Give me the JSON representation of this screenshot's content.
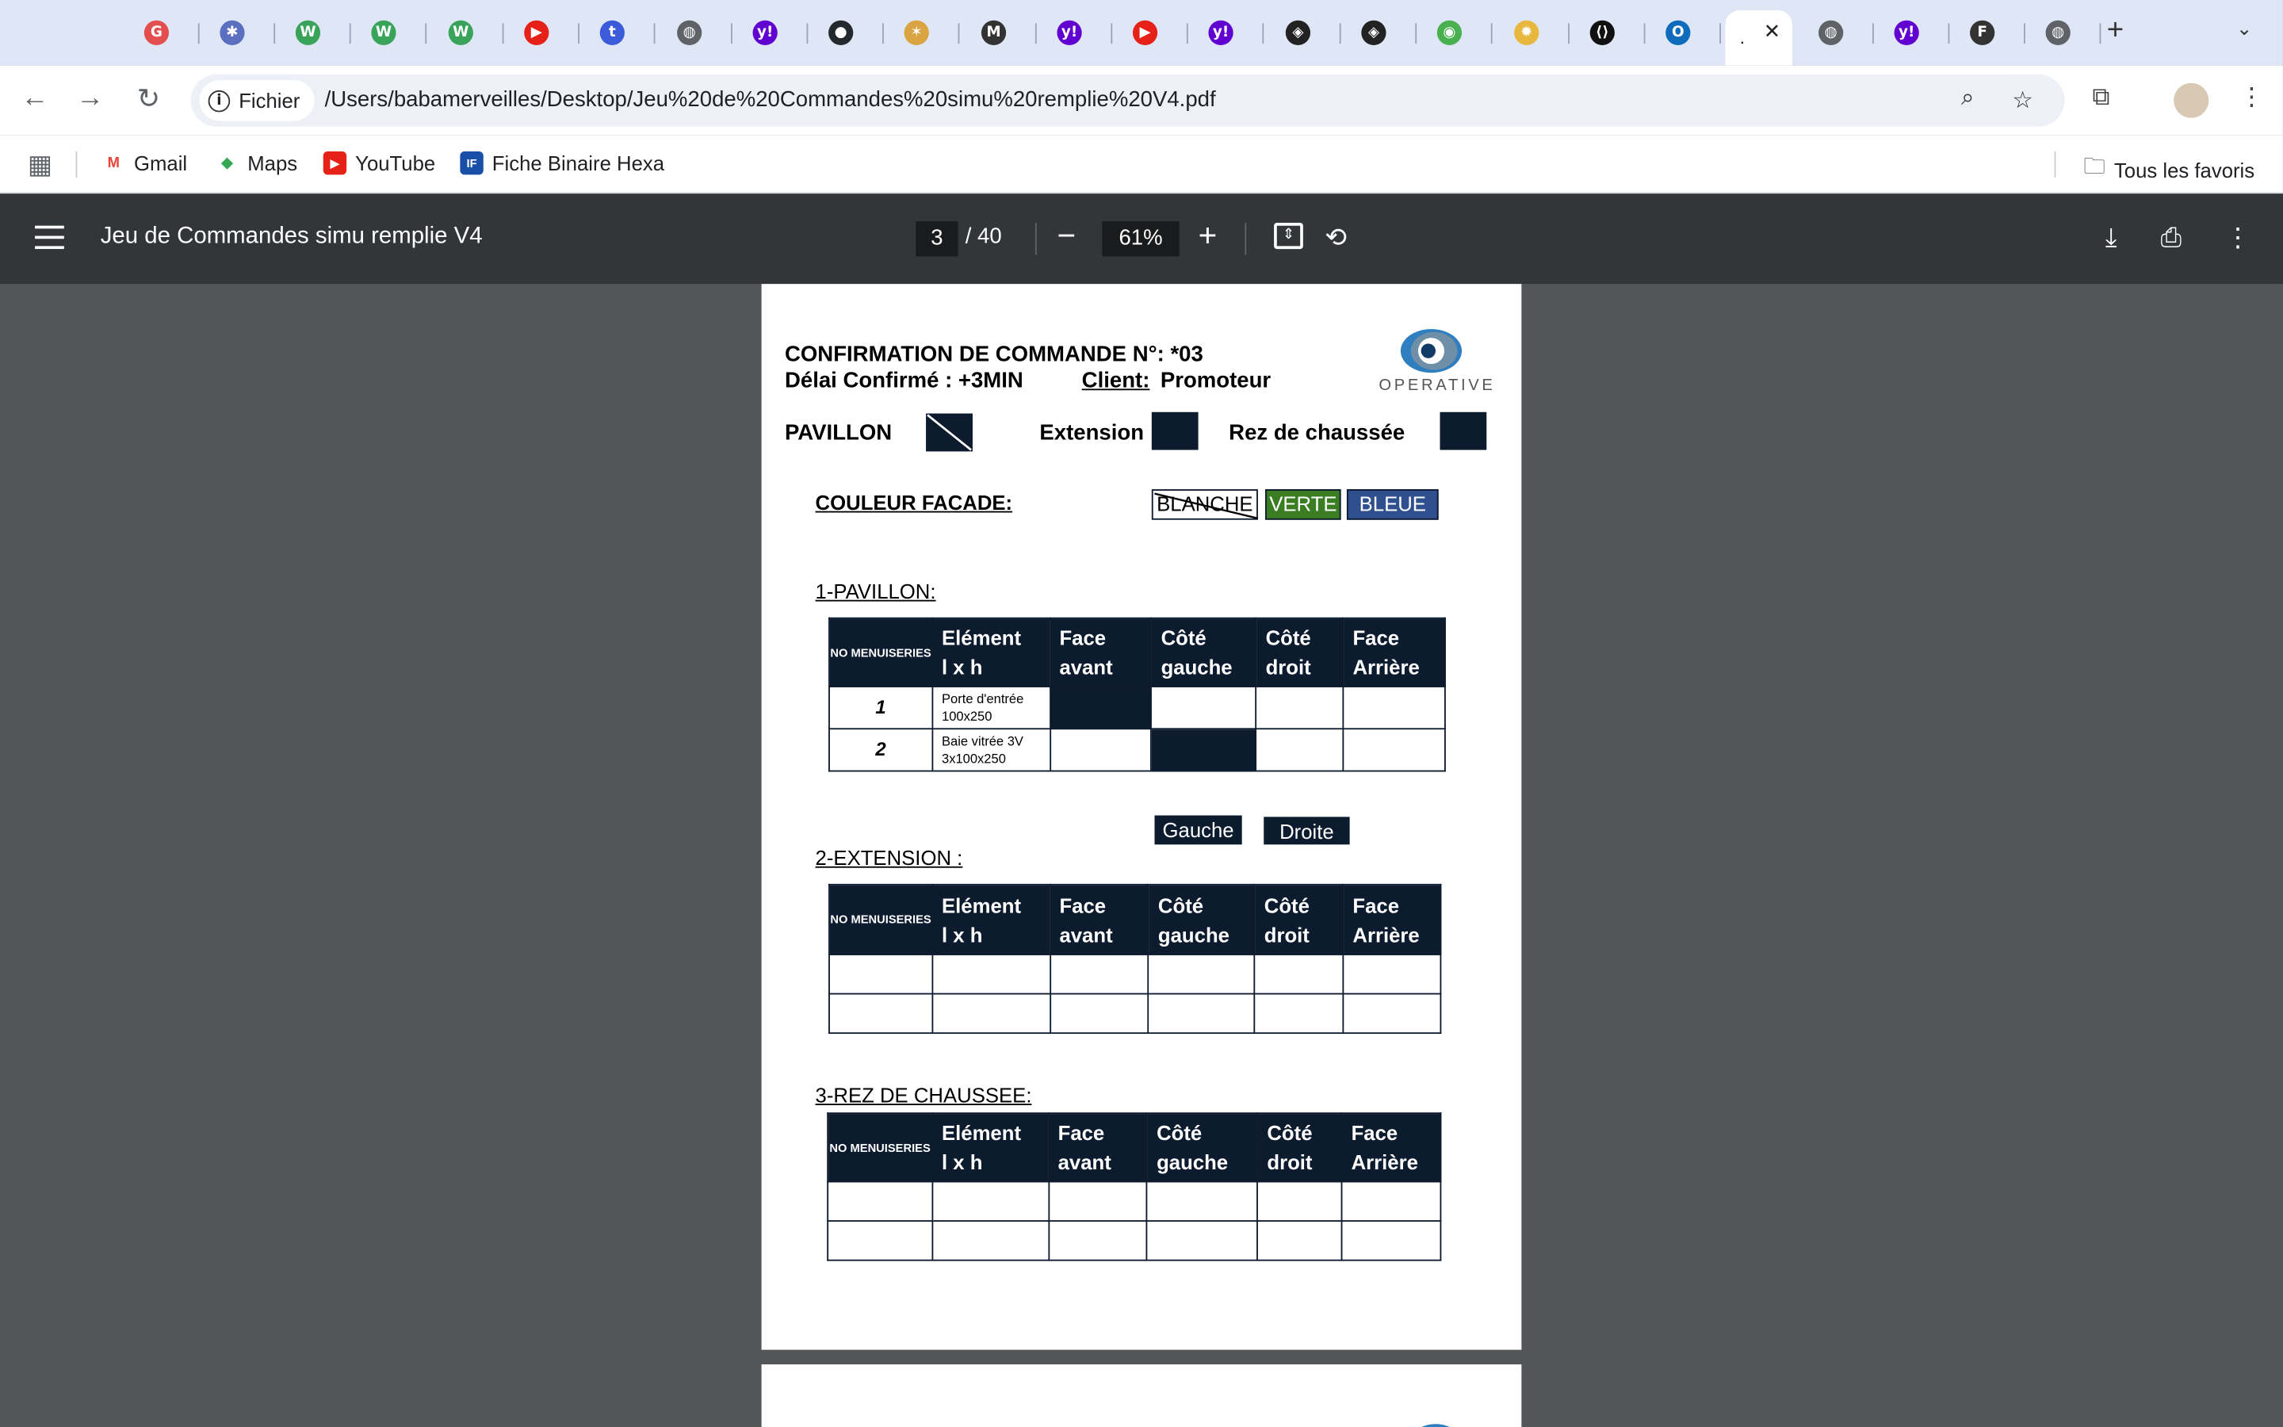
{
  "browser": {
    "tabs": [
      {
        "icon": "tab-icon-1",
        "color": "#e34f4f",
        "glyph": "G"
      },
      {
        "icon": "tab-icon-2",
        "color": "#5a6fbf",
        "glyph": "✱"
      },
      {
        "icon": "tab-icon-3",
        "color": "#3aa35a",
        "glyph": "W"
      },
      {
        "icon": "tab-icon-4",
        "color": "#3aa35a",
        "glyph": "W"
      },
      {
        "icon": "tab-icon-5",
        "color": "#3aa35a",
        "glyph": "W"
      },
      {
        "icon": "youtube-icon",
        "color": "#e62117",
        "glyph": "▶"
      },
      {
        "icon": "tab-icon-7",
        "color": "#3b5bdb",
        "glyph": "t"
      },
      {
        "icon": "globe-icon",
        "color": "#5f6368",
        "glyph": "◍"
      },
      {
        "icon": "yahoo-icon",
        "color": "#6001d2",
        "glyph": "y!"
      },
      {
        "icon": "github-icon",
        "color": "#24292e",
        "glyph": "●"
      },
      {
        "icon": "tab-icon-11",
        "color": "#d9a441",
        "glyph": "✶"
      },
      {
        "icon": "tab-icon-12",
        "color": "#333333",
        "glyph": "M"
      },
      {
        "icon": "yahoo-icon",
        "color": "#6001d2",
        "glyph": "y!"
      },
      {
        "icon": "youtube-icon",
        "color": "#e62117",
        "glyph": "▶"
      },
      {
        "icon": "yahoo-icon",
        "color": "#6001d2",
        "glyph": "y!"
      },
      {
        "icon": "tab-icon-16",
        "color": "#222222",
        "glyph": "◈"
      },
      {
        "icon": "tab-icon-17",
        "color": "#222222",
        "glyph": "◈"
      },
      {
        "icon": "tab-icon-18",
        "color": "#48b04f",
        "glyph": "◉"
      },
      {
        "icon": "tab-icon-19",
        "color": "#e7b83d",
        "glyph": "✹"
      },
      {
        "icon": "tab-icon-20",
        "color": "#111111",
        "glyph": "⟨⟩"
      },
      {
        "icon": "outlook-icon",
        "color": "#0f6cbd",
        "glyph": "O"
      },
      {
        "icon": "active-tab",
        "color": "#ffffff",
        "glyph": "."
      },
      {
        "icon": "globe-icon",
        "color": "#5f6368",
        "glyph": "◍"
      },
      {
        "icon": "yahoo-icon",
        "color": "#6001d2",
        "glyph": "y!"
      },
      {
        "icon": "tab-icon-25",
        "color": "#333333",
        "glyph": "F"
      },
      {
        "icon": "globe-icon",
        "color": "#5f6368",
        "glyph": "◍"
      }
    ],
    "active_tab_label": ".",
    "address": {
      "chip_label": "Fichier",
      "url": "/Users/babamerveilles/Desktop/Jeu%20de%20Commandes%20simu%20remplie%20V4.pdf"
    },
    "bookmarks": [
      {
        "label": "Gmail",
        "icon": "gmail-icon"
      },
      {
        "label": "Maps",
        "icon": "maps-icon"
      },
      {
        "label": "YouTube",
        "icon": "youtube-icon"
      },
      {
        "label": "Fiche Binaire Hexa",
        "icon": "bookmark-icon"
      }
    ],
    "all_bookmarks": "Tous les favoris"
  },
  "pdf_viewer": {
    "title": "Jeu de Commandes simu remplie V4",
    "current_page": "3",
    "total_pages": "/ 40",
    "zoom": "61%"
  },
  "document": {
    "heading_line1": "CONFIRMATION DE COMMANDE N°: *03",
    "delay_label": "Délai Confirmé : +3MIN",
    "client_label": "Client:",
    "client_value": "Promoteur",
    "logo_text": "OPERATIVE",
    "pavillon_label": "PAVILLON",
    "extension_label": "Extension",
    "rdc_label": "Rez de chaussée",
    "couleur_label": "COULEUR FACADE:",
    "colors": [
      {
        "label": "BLANCHE",
        "bg": "#ffffff",
        "fg": "#000000",
        "crossed": true
      },
      {
        "label": "VERTE",
        "bg": "#3b7d23",
        "fg": "#ffffff",
        "crossed": false
      },
      {
        "label": "BLEUE",
        "bg": "#2f4f8f",
        "fg": "#ffffff",
        "crossed": false
      }
    ],
    "section1": "1-PAVILLON:",
    "section2": "2-EXTENSION :",
    "section3": "3-REZ DE CHAUSSEE:",
    "headers": {
      "no": "NO MENUISERIES",
      "element1": "Elément",
      "element2": "l x h",
      "face_avant1": "Face",
      "face_avant2": "avant",
      "cote_g1": "Côté",
      "cote_g2": "gauche",
      "cote_d1": "Côté",
      "cote_d2": "droit",
      "face_ar1": "Face",
      "face_ar2": "Arrière"
    },
    "pavillon_rows": [
      {
        "no": "1",
        "element": "Porte d'entrée",
        "dims": "100x250"
      },
      {
        "no": "2",
        "element": "Baie vitrée 3V",
        "dims": "3x100x250"
      }
    ],
    "gauche_label": "Gauche",
    "droite_label": "Droite"
  }
}
